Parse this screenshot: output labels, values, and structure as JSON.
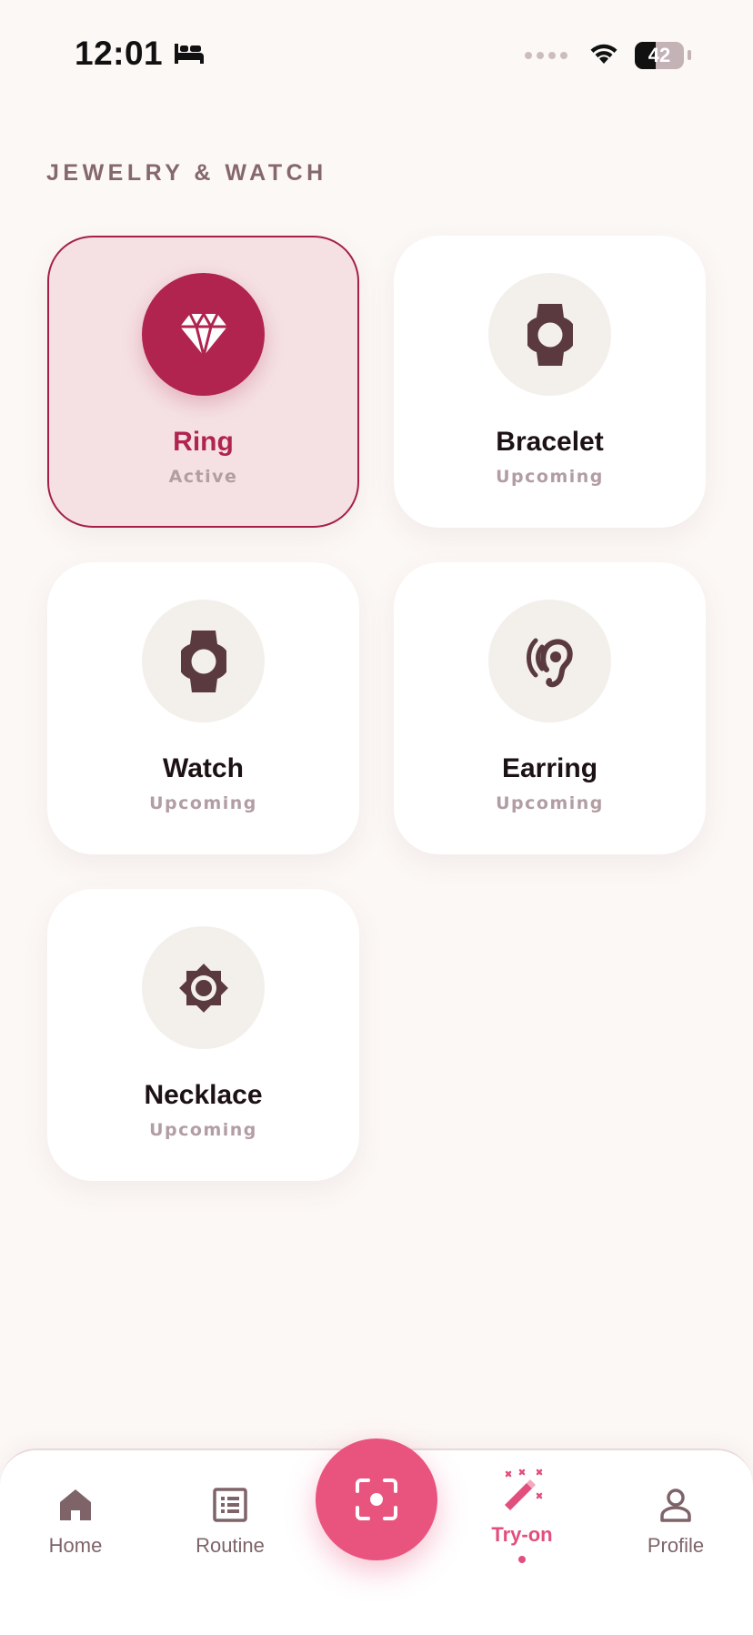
{
  "status_bar": {
    "time": "12:01",
    "battery_level": "42",
    "battery_fraction": 0.42
  },
  "section": {
    "title": "JEWELRY & WATCH"
  },
  "categories": [
    {
      "name": "Ring",
      "status": "Active",
      "icon": "diamond-icon",
      "active": true
    },
    {
      "name": "Bracelet",
      "status": "Upcoming",
      "icon": "watch-icon",
      "active": false
    },
    {
      "name": "Watch",
      "status": "Upcoming",
      "icon": "watch-icon",
      "active": false
    },
    {
      "name": "Earring",
      "status": "Upcoming",
      "icon": "ear-icon",
      "active": false
    },
    {
      "name": "Necklace",
      "status": "Upcoming",
      "icon": "brightness-icon",
      "active": false
    }
  ],
  "nav": {
    "home": "Home",
    "routine": "Routine",
    "tryon": "Try-on",
    "profile": "Profile",
    "active": "tryon"
  },
  "colors": {
    "accent": "#b0244f",
    "nav_accent": "#e9547e",
    "background": "#fcf8f6",
    "icon_dark": "#5a3a3e"
  }
}
